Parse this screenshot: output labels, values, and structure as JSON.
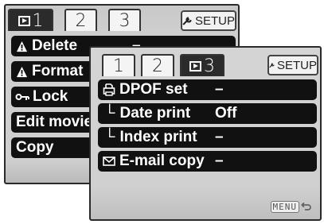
{
  "back_panel": {
    "tabs": [
      {
        "label": "1",
        "icon": "play-icon",
        "active": true
      },
      {
        "label": "2",
        "active": false
      },
      {
        "label": "3",
        "active": false
      }
    ],
    "setup_label": "SETUP",
    "items": [
      {
        "icon": "warning-icon",
        "label": "Delete",
        "value": "–"
      },
      {
        "icon": "warning-icon",
        "label": "Format"
      },
      {
        "icon": "key-icon",
        "label": "Lock"
      },
      {
        "label": "Edit movie"
      },
      {
        "label": "Copy"
      }
    ]
  },
  "front_panel": {
    "tabs": [
      {
        "label": "1",
        "active": false
      },
      {
        "label": "2",
        "active": false
      },
      {
        "label": "3",
        "icon": "play-icon",
        "active": true
      }
    ],
    "setup_label": "SETUP",
    "items": [
      {
        "icon": "printer-icon",
        "label": "DPOF set",
        "value": "–"
      },
      {
        "prefix": "└",
        "label": "Date print",
        "value": "Off"
      },
      {
        "prefix": "└",
        "label": "Index print",
        "value": "–"
      },
      {
        "icon": "envelope-icon",
        "label": "E-mail copy",
        "value": "–"
      }
    ],
    "menu_label": "MENU"
  }
}
